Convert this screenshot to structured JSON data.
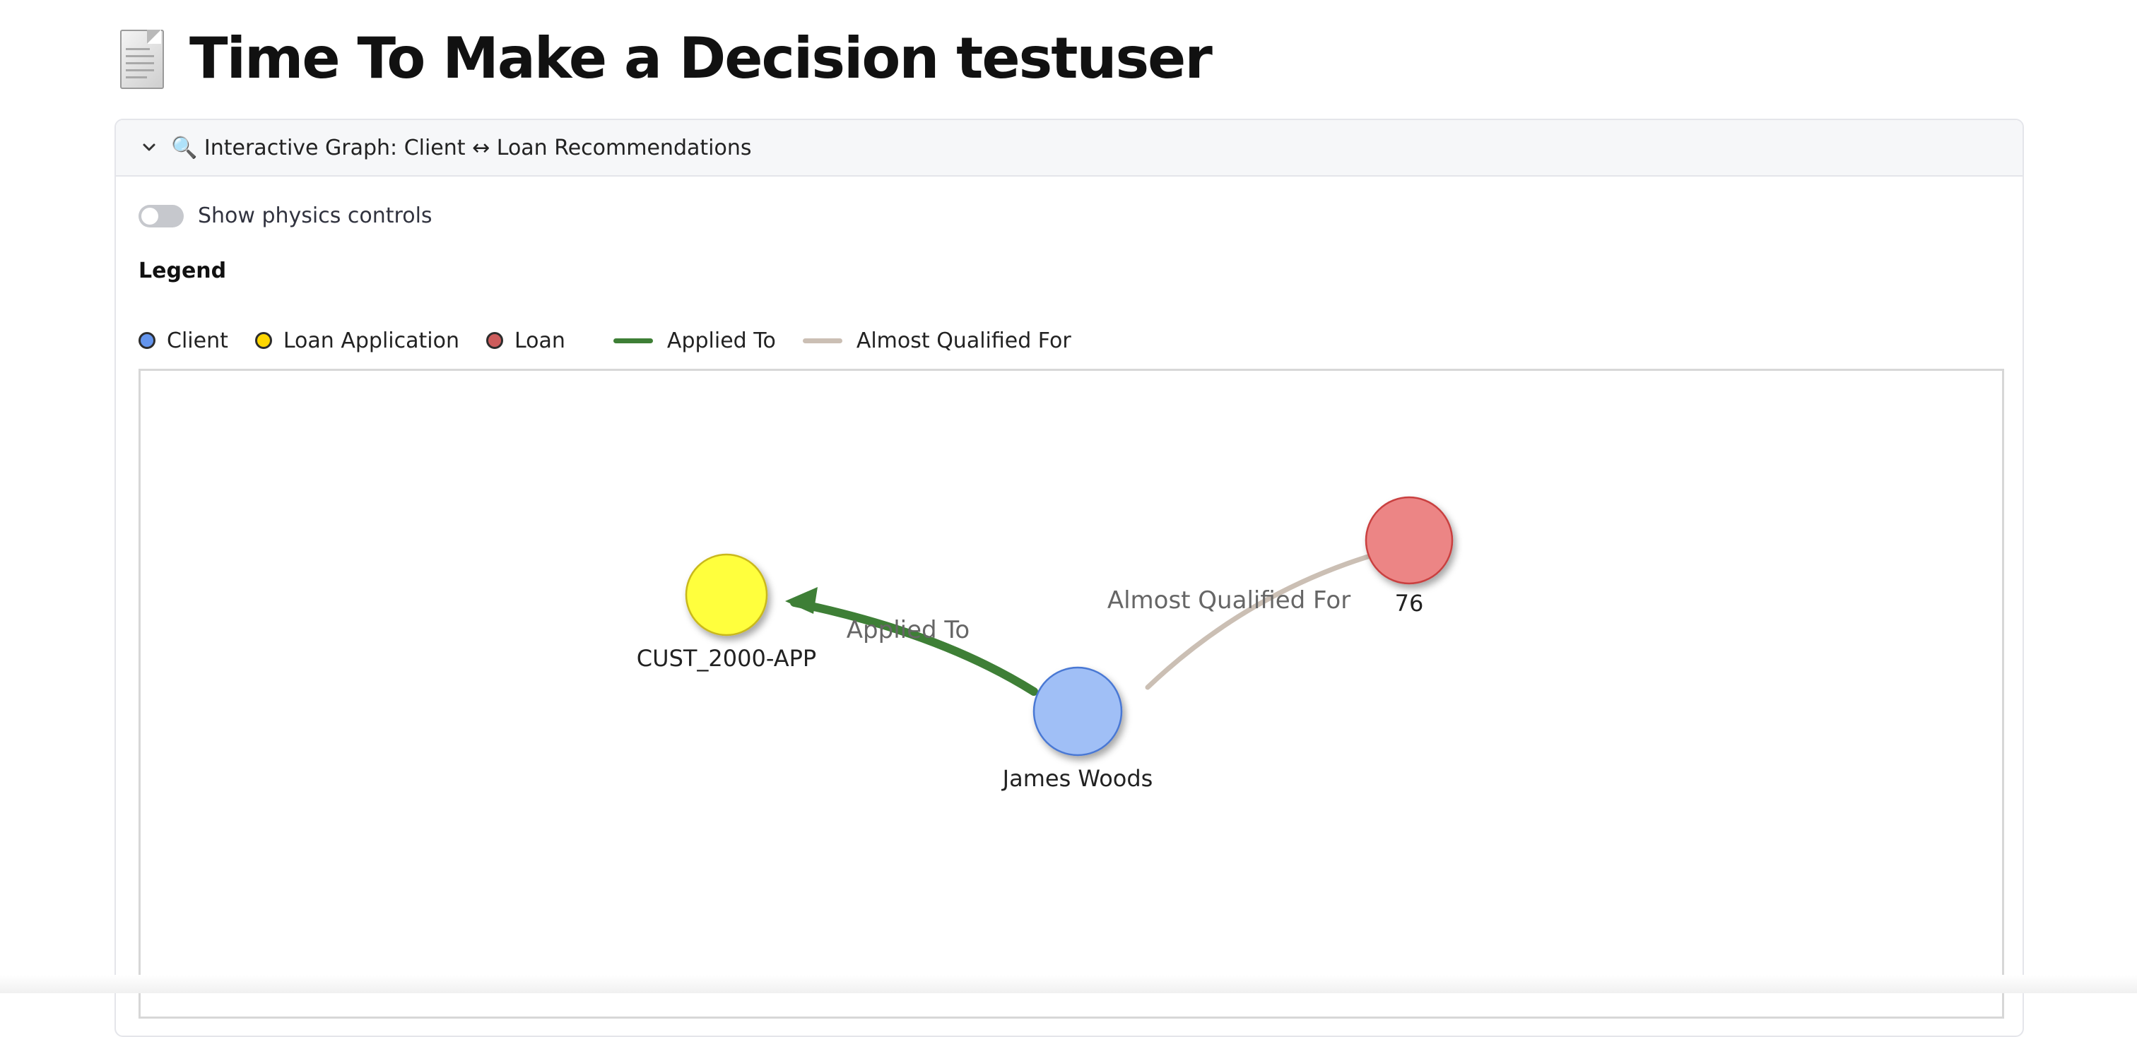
{
  "header": {
    "title": "Time To Make a Decision testuser",
    "icon": "page-facing-up-icon"
  },
  "expander": {
    "label": "🔍 Interactive Graph: Client ↔ Loan Recommendations",
    "expanded": true,
    "toggle": {
      "label": "Show physics controls",
      "checked": false
    },
    "legend": {
      "title": "Legend",
      "items": [
        {
          "kind": "node",
          "label": "Client",
          "color": "#6495ED"
        },
        {
          "kind": "node",
          "label": "Loan Application",
          "color": "#FFD700"
        },
        {
          "kind": "node",
          "label": "Loan",
          "color": "#CD5C5C"
        },
        {
          "kind": "edge",
          "label": "Applied To",
          "color": "#3E7F36"
        },
        {
          "kind": "edge",
          "label": "Almost Qualified For",
          "color": "#CBBFB4"
        }
      ]
    },
    "graph": {
      "nodes": [
        {
          "id": "client",
          "label": "James Woods",
          "type": "Client",
          "fill": "#A0BFF6",
          "stroke": "#4A78D4"
        },
        {
          "id": "application",
          "label": "CUST_2000-APP",
          "type": "Loan Application",
          "fill": "#FFFF3C",
          "stroke": "#C9B81E"
        },
        {
          "id": "loan",
          "label": "76",
          "type": "Loan",
          "fill": "#EC8585",
          "stroke": "#C9403F"
        }
      ],
      "edges": [
        {
          "from": "client",
          "to": "application",
          "label": "Applied To",
          "color": "#3E7F36"
        },
        {
          "from": "client",
          "to": "loan",
          "label": "Almost Qualified For",
          "color": "#CBBFB4"
        }
      ]
    }
  }
}
